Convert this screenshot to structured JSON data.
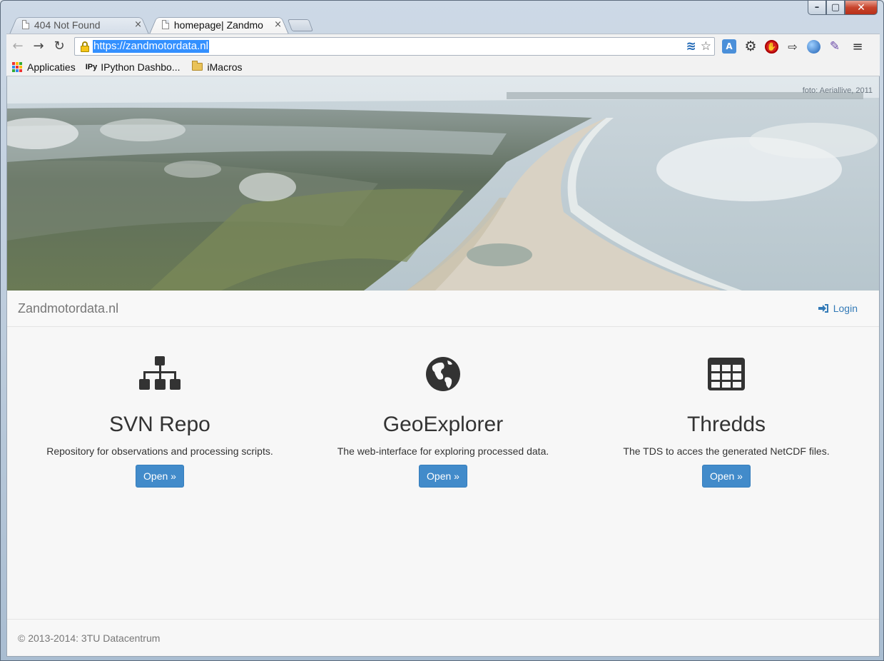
{
  "browser": {
    "tabs": [
      {
        "title": "404 Not Found",
        "close": "×",
        "active": false
      },
      {
        "title": "homepage| Zandmo",
        "close": "×",
        "active": true
      }
    ],
    "window_controls": {
      "minimize": "–",
      "maximize": "▢",
      "close": "✕"
    },
    "nav": {
      "back": "←",
      "forward": "→",
      "reload": "↻"
    },
    "url": "https://zandmotordata.nl",
    "omnibox_icons": {
      "waves": "≋",
      "star": "☆"
    },
    "extensions": [
      "translate-icon",
      "gear-icon",
      "stop-icon",
      "phone-icon",
      "globe-icon",
      "eyedropper-icon",
      "menu-icon"
    ],
    "extension_glyphs": {
      "translate": "A",
      "gear": "⚙",
      "stop": "✋",
      "phone": "⇨",
      "dropper": "✎",
      "menu": "≡"
    },
    "bookmarks": [
      {
        "label": "Applicaties",
        "icon": "apps-icon"
      },
      {
        "label": "IPython Dashbo...",
        "icon": "ipython-icon",
        "icon_text": "IPy"
      },
      {
        "label": "iMacros",
        "icon": "folder-icon"
      }
    ]
  },
  "page": {
    "hero_credit": "foto: Aeriallive, 2011",
    "brand": "Zandmotordata.nl",
    "login_label": "Login",
    "columns": [
      {
        "icon": "sitemap-icon",
        "title": "SVN Repo",
        "description": "Repository for observations and processing scripts.",
        "button": "Open »"
      },
      {
        "icon": "globe-icon",
        "title": "GeoExplorer",
        "description": "The web-interface for exploring processed data.",
        "button": "Open »"
      },
      {
        "icon": "table-icon",
        "title": "Thredds",
        "description": "The TDS to acces the generated NetCDF files.",
        "button": "Open »"
      }
    ],
    "footer": "© 2013-2014: 3TU Datacentrum"
  },
  "colors": {
    "accent": "#428bca",
    "link": "#337ab7",
    "url_highlight": "#3390ff"
  }
}
